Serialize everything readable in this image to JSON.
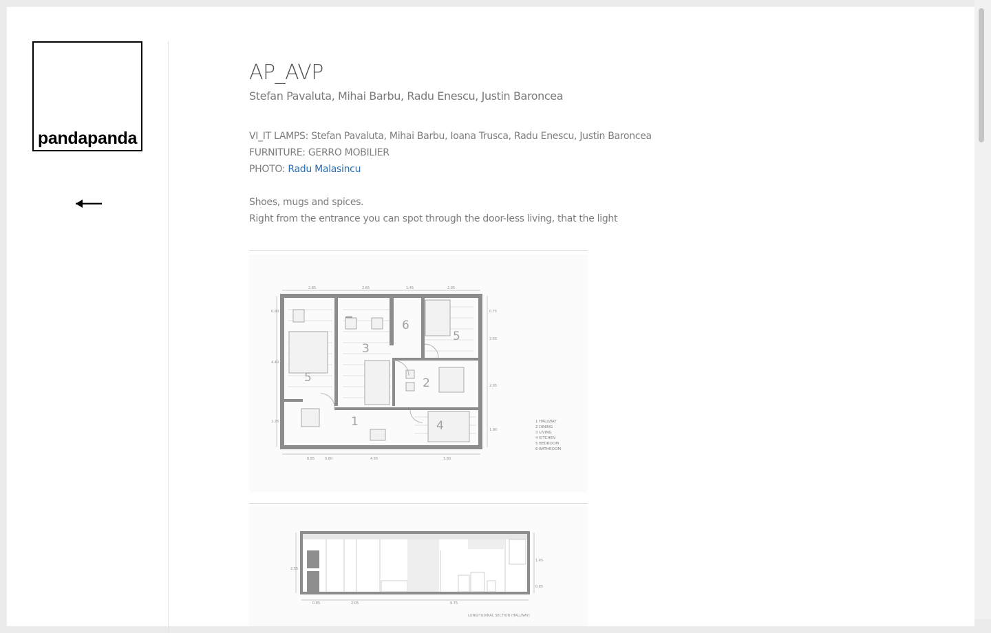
{
  "logo": {
    "text": "pandapanda"
  },
  "navigation": {
    "back_icon": "left-arrow-icon"
  },
  "project": {
    "title": "AP_AVP",
    "authors": "Stefan Pavaluta, Mihai Barbu, Radu Enescu, Justin Baroncea",
    "credits": {
      "lamps": "VI_IT LAMPS: Stefan Pavaluta, Mihai Barbu, Ioana Trusca, Radu Enescu, Justin Baroncea",
      "furniture": "FURNITURE: GERRO MOBILIER",
      "photo_label": "PHOTO:",
      "photo_link": "Radu Malasincu"
    },
    "description": [
      "Shoes, mugs and spices.",
      "Right from the entrance you can spot through the door-less living, that the light"
    ]
  },
  "plan": {
    "room_numbers": [
      "1",
      "2",
      "3",
      "4",
      "5",
      "5",
      "6"
    ],
    "legend": [
      "1 HALLWAY",
      "2 DINING",
      "3 LIVING",
      "4 KITCHEN",
      "5 BEDROOM",
      "6 BATHROOM"
    ],
    "top_dims": [
      "2.85",
      "2.65",
      "1.45",
      "2.95"
    ],
    "bottom_dims": [
      "0.85",
      "0.80",
      "4.55",
      "3.80"
    ],
    "left_dims": [
      "0.80",
      "4.40",
      "1.25"
    ],
    "right_dims": [
      "0.75",
      "2.55",
      "2.05",
      "1.90"
    ]
  },
  "section": {
    "caption": "LONGITUDINAL SECTION (HALLWAY)",
    "bottom_dims": [
      "0.85",
      "2.05",
      "6.75"
    ],
    "left_dims": [
      "2.55"
    ],
    "right_dims": [
      "1.45",
      "0.85"
    ]
  },
  "colors": {
    "link": "#2a6fb2",
    "text": "#7c7c7c",
    "title": "#555555"
  }
}
